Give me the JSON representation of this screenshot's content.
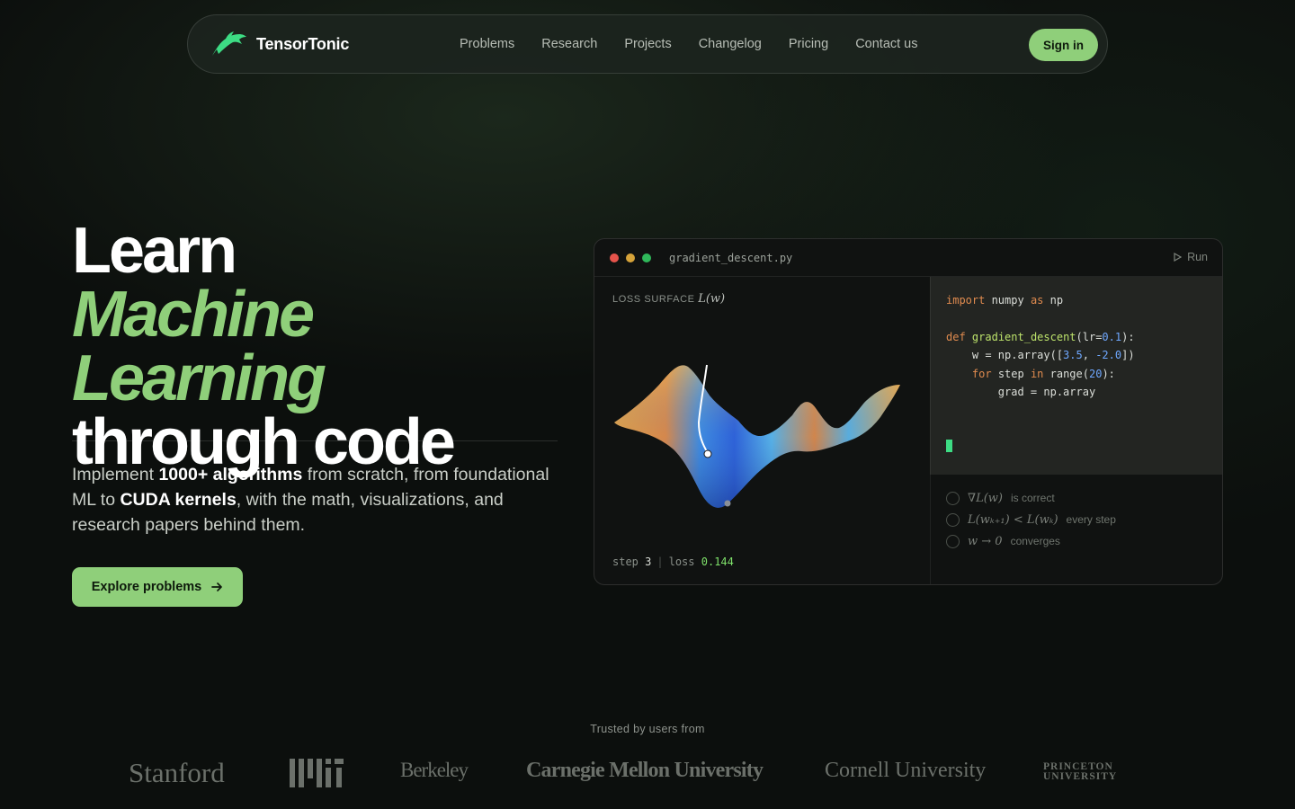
{
  "nav": {
    "brand": "TensorTonic",
    "links": [
      "Problems",
      "Research",
      "Projects",
      "Changelog",
      "Pricing",
      "Contact us"
    ],
    "signin": "Sign in"
  },
  "hero": {
    "line1": "Learn",
    "line2": "Machine Learning",
    "line3": "through code",
    "desc_pre": "Implement ",
    "desc_b1": "1000+ algorithms",
    "desc_mid1": " from scratch, from foundational ML to ",
    "desc_b2": "CUDA kernels",
    "desc_mid2": ", with the math, visualizations, and research papers behind them.",
    "cta": "Explore problems"
  },
  "card": {
    "filename": "gradient_descent.py",
    "run": "Run",
    "viz_label": "LOSS SURFACE",
    "viz_math": "L(w)",
    "step_label": "step",
    "step_value": "3",
    "loss_label": "loss",
    "loss_value": "0.144",
    "checks": [
      {
        "math": "∇L(w)",
        "text": "is correct"
      },
      {
        "math": "L(wₖ₊₁) < L(wₖ)",
        "text": "every step"
      },
      {
        "math": "w → 0",
        "text": "converges"
      }
    ]
  },
  "trusted": {
    "label": "Trusted by users from",
    "stanford": "Stanford",
    "berkeley": "Berkeley",
    "cmu": "Carnegie Mellon University",
    "cornell": "Cornell University",
    "princeton1": "PRINCETON",
    "princeton2": "UNIVERSITY"
  },
  "colors": {
    "accent": "#8fcf7a",
    "background": "#0c0f0d",
    "dot_red": "#e5534b",
    "dot_yellow": "#d6a33a",
    "dot_green": "#2fb85a"
  }
}
